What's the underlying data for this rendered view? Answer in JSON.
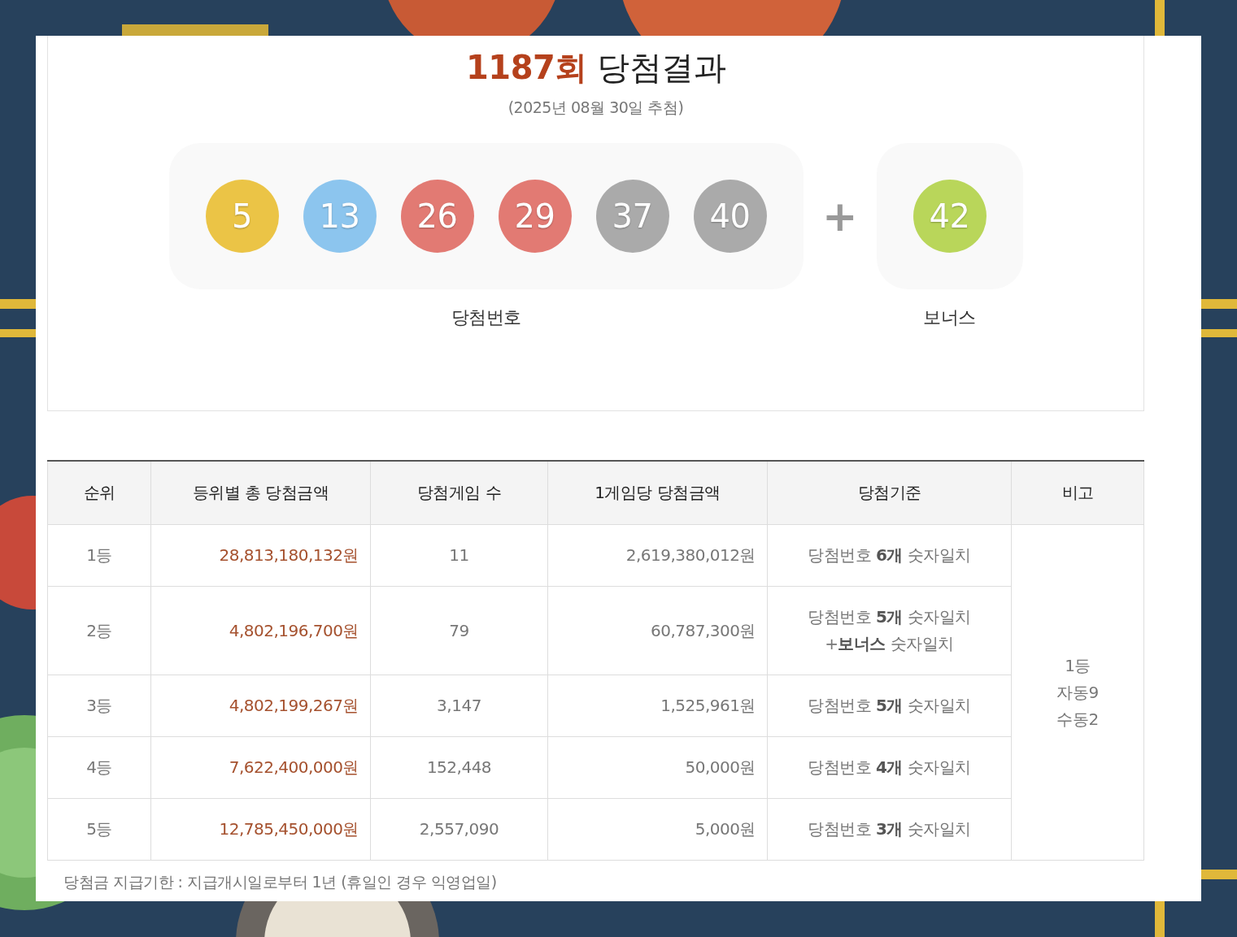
{
  "header": {
    "round": "1187회",
    "title": "당첨결과",
    "date": "(2025년 08월 30일 추첨)"
  },
  "winning_numbers": {
    "label": "당첨번호",
    "balls": [
      {
        "number": "5",
        "color": "#ebc446"
      },
      {
        "number": "13",
        "color": "#8cc5ee"
      },
      {
        "number": "26",
        "color": "#e27a73"
      },
      {
        "number": "29",
        "color": "#e27a73"
      },
      {
        "number": "37",
        "color": "#aaaaaa"
      },
      {
        "number": "40",
        "color": "#aaaaaa"
      }
    ]
  },
  "plus": "+",
  "bonus": {
    "label": "보너스",
    "number": "42",
    "color": "#b9d65a"
  },
  "table": {
    "columns": [
      "순위",
      "등위별 총 당첨금액",
      "당첨게임 수",
      "1게임당 당첨금액",
      "당첨기준",
      "비고"
    ],
    "rows": [
      {
        "rank": "1등",
        "total": "28,813,180,132원",
        "winners": "11",
        "per_game": "2,619,380,012원",
        "criteria": [
          "당첨번호 **6개** 숫자일치"
        ]
      },
      {
        "rank": "2등",
        "total": "4,802,196,700원",
        "winners": "79",
        "per_game": "60,787,300원",
        "criteria": [
          "당첨번호 **5개** 숫자일치",
          "+**보너스** 숫자일치"
        ]
      },
      {
        "rank": "3등",
        "total": "4,802,199,267원",
        "winners": "3,147",
        "per_game": "1,525,961원",
        "criteria": [
          "당첨번호 **5개** 숫자일치"
        ]
      },
      {
        "rank": "4등",
        "total": "7,622,400,000원",
        "winners": "152,448",
        "per_game": "50,000원",
        "criteria": [
          "당첨번호 **4개** 숫자일치"
        ]
      },
      {
        "rank": "5등",
        "total": "12,785,450,000원",
        "winners": "2,557,090",
        "per_game": "5,000원",
        "criteria": [
          "당첨번호 **3개** 숫자일치"
        ]
      }
    ],
    "note": [
      "1등",
      "자동9",
      "수동2"
    ]
  },
  "footnote": "당첨금 지급기한 : 지급개시일로부터 1년 (휴일인 경우 익영업일)"
}
